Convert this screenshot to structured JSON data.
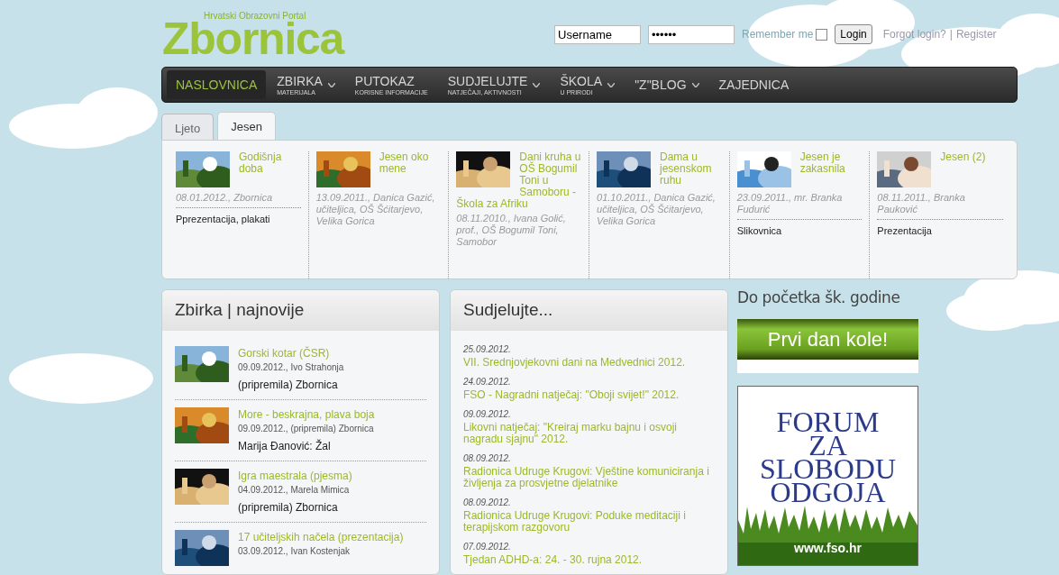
{
  "logo": {
    "subtitle": "Hrvatski Obrazovni Portal",
    "title": "Zbornica"
  },
  "login": {
    "username": "Username",
    "password": "••••••",
    "remember_label": "Remember me",
    "remember": false,
    "button": "Login",
    "forgot": "Forgot login?",
    "separator": "|",
    "register": "Register"
  },
  "nav": [
    {
      "label": "NASLOVNICA",
      "dropdown": false,
      "selected": true
    },
    {
      "label": "ZBIRKA",
      "sub": "MATERIJALA",
      "dropdown": true,
      "selected": false
    },
    {
      "label": "PUTOKAZ",
      "sub": "KORISNE INFORMACIJE",
      "dropdown": false,
      "selected": false
    },
    {
      "label": "SUDJELUJTE",
      "sub": "NATJEČAJI, AKTIVNOSTI",
      "dropdown": true,
      "selected": false
    },
    {
      "label": "ŠKOLA",
      "sub": "U PRIRODI",
      "dropdown": true,
      "selected": false
    },
    {
      "label": "\"Z\"BLOG",
      "dropdown": true,
      "selected": false
    },
    {
      "label": "ZAJEDNICA",
      "dropdown": false,
      "selected": false
    }
  ],
  "tabs": [
    {
      "label": "Ljeto",
      "selected": false
    },
    {
      "label": "Jesen",
      "selected": true
    }
  ],
  "featured": [
    {
      "title": "Godišnja doba",
      "meta": "08.01.2012., Zbornica",
      "category": "Pprezentacija, plakati"
    },
    {
      "title": "Jesen oko mene",
      "meta": "13.09.2011., Danica Gazić, učiteljica, OŠ Šćitarjevo, Velika Gorica"
    },
    {
      "title": "Dani kruha u OŠ Bogumil Toni u Samoboru - Škola za Afriku",
      "meta": "08.11.2010., Ivana Golić, prof., OŠ Bogumil Toni, Samobor"
    },
    {
      "title": "Dama u jesenskom ruhu",
      "meta": "01.10.2011., Danica Gazić, učiteljica, OŠ Šćitarjevo, Velika Gorica"
    },
    {
      "title": "Jesen je zakasnila",
      "meta": "23.09.2011., mr. Branka Fudurić",
      "category": "Slikovnica"
    },
    {
      "title": "Jesen (2)",
      "meta": "08.11.2011., Branka Pauković",
      "category": "Prezentacija"
    }
  ],
  "zbirka": {
    "title": "Zbirka | najnovije",
    "items": [
      {
        "title": "Gorski kotar (ČSR)",
        "meta": "09.09.2012., Ivo Strahonja",
        "note": "(pripremila) Zbornica"
      },
      {
        "title": "More - beskrajna, plava boja",
        "meta": "09.09.2012., (pripremila) Zbornica",
        "note": "Marija Đanović: Žal"
      },
      {
        "title": "Igra maestrala (pjesma)",
        "meta": "04.09.2012., Marela Mimica",
        "note": "(pripremila) Zbornica"
      },
      {
        "title": "17 učiteljskih načela (prezentacija)",
        "meta": "03.09.2012., Ivan Kostenjak"
      }
    ]
  },
  "sudjelujte": {
    "title": "Sudjelujte...",
    "items": [
      {
        "date": "25.09.2012.",
        "title": "VII. Srednjovjekovni dani na Medvednici 2012."
      },
      {
        "date": "24.09.2012.",
        "title": "FSO - Nagradni natječaj: \"Oboji svijet!\" 2012."
      },
      {
        "date": "09.09.2012.",
        "title": "Likovni natječaj: \"Kreiraj marku bajnu i osvoji nagradu sjajnu\" 2012."
      },
      {
        "date": "08.09.2012.",
        "title": "Radionica Udruge Krugovi: Vještine komuniciranja i življenja za prosvjetne djelatnike"
      },
      {
        "date": "08.09.2012.",
        "title": "Radionica Udruge Krugovi: Poduke meditaciji i terapijskom razgovoru"
      },
      {
        "date": "07.09.2012.",
        "title": "Tjedan ADHD-a: 24. - 30. rujna 2012."
      }
    ]
  },
  "sidebar": {
    "title": "Do početka šk. godine",
    "banner": "Prvi dan kole!",
    "fso_lines": [
      "FORUM",
      "ZA",
      "SLOBODU",
      "ODGOJA"
    ],
    "fso_url": "www.fso.hr"
  }
}
